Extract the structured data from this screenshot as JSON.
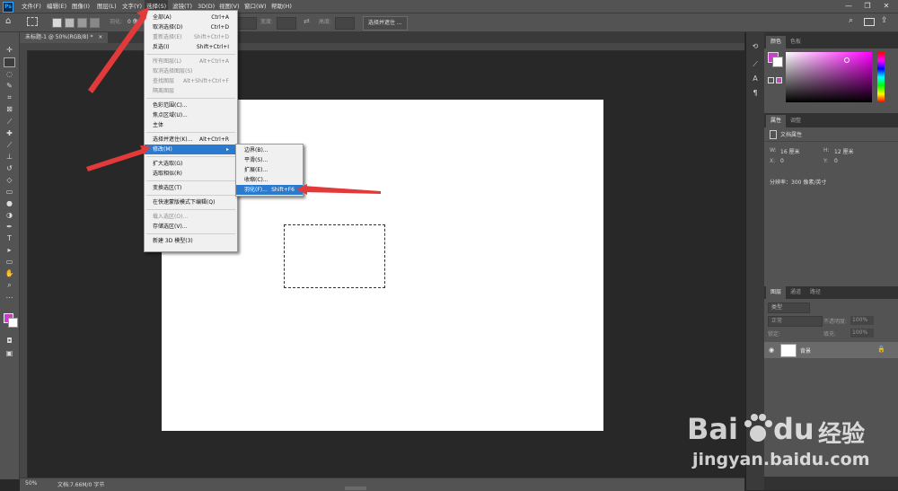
{
  "menubar": {
    "logo": "Ps",
    "items": [
      "文件(F)",
      "编辑(E)",
      "图像(I)",
      "图层(L)",
      "文字(Y)",
      "选择(S)",
      "滤镜(T)",
      "3D(D)",
      "视图(V)",
      "窗口(W)",
      "帮助(H)"
    ],
    "window_controls": [
      "—",
      "❐",
      "✕"
    ]
  },
  "options_bar": {
    "feather_label": "羽化:",
    "feather_value": "0 像素",
    "width_label": "宽度:",
    "height_label": "高度:",
    "select_mask_button": "选择并遮住 ..."
  },
  "document_tab": {
    "label": "未标题-1 @ 50%(RGB/8) *",
    "close": "×"
  },
  "status_bar": {
    "zoom": "50%",
    "doc_info": "文档:7.66M/0 字节"
  },
  "select_menu": {
    "groups": [
      [
        {
          "label": "全部(A)",
          "shortcut": "Ctrl+A",
          "disabled": false
        },
        {
          "label": "取消选择(D)",
          "shortcut": "Ctrl+D",
          "disabled": false
        },
        {
          "label": "重新选择(E)",
          "shortcut": "Shift+Ctrl+D",
          "disabled": true
        },
        {
          "label": "反选(I)",
          "shortcut": "Shift+Ctrl+I",
          "disabled": false
        }
      ],
      [
        {
          "label": "所有图层(L)",
          "shortcut": "Alt+Ctrl+A",
          "disabled": true
        },
        {
          "label": "取消选择图层(S)",
          "shortcut": "",
          "disabled": true
        },
        {
          "label": "查找图层",
          "shortcut": "Alt+Shift+Ctrl+F",
          "disabled": true
        },
        {
          "label": "隔离图层",
          "shortcut": "",
          "disabled": true
        }
      ],
      [
        {
          "label": "色彩范围(C)...",
          "shortcut": "",
          "disabled": false
        },
        {
          "label": "焦点区域(U)...",
          "shortcut": "",
          "disabled": false
        },
        {
          "label": "主体",
          "shortcut": "",
          "disabled": false
        }
      ],
      [
        {
          "label": "选择并遮住(K)...",
          "shortcut": "Alt+Ctrl+R",
          "disabled": false
        },
        {
          "label": "修改(M)",
          "shortcut": "",
          "disabled": false,
          "submenu": true,
          "highlighted": true
        }
      ],
      [
        {
          "label": "扩大选取(G)",
          "shortcut": "",
          "disabled": false
        },
        {
          "label": "选取相似(R)",
          "shortcut": "",
          "disabled": false
        }
      ],
      [
        {
          "label": "变换选区(T)",
          "shortcut": "",
          "disabled": false
        }
      ],
      [
        {
          "label": "在快速蒙版模式下编辑(Q)",
          "shortcut": "",
          "disabled": false
        }
      ],
      [
        {
          "label": "载入选区(O)...",
          "shortcut": "",
          "disabled": true
        },
        {
          "label": "存储选区(V)...",
          "shortcut": "",
          "disabled": false
        }
      ],
      [
        {
          "label": "新建 3D 模型(3)",
          "shortcut": "",
          "disabled": false
        }
      ]
    ]
  },
  "modify_submenu": {
    "items": [
      {
        "label": "边界(B)...",
        "shortcut": ""
      },
      {
        "label": "平滑(S)...",
        "shortcut": ""
      },
      {
        "label": "扩展(E)...",
        "shortcut": ""
      },
      {
        "label": "收缩(C)...",
        "shortcut": ""
      },
      {
        "label": "羽化(F)...",
        "shortcut": "Shift+F6",
        "highlighted": true
      }
    ]
  },
  "color_panel": {
    "tabs": [
      "颜色",
      "色板"
    ],
    "fg_color": "#c83fc8",
    "bg_color": "#ffffff"
  },
  "properties_panel": {
    "tabs": [
      "属性",
      "调整"
    ],
    "section": "文档属性",
    "w_label": "W:",
    "w_value": "16 厘米",
    "h_label": "H:",
    "h_value": "12 厘米",
    "x_label": "X:",
    "x_value": "0",
    "y_label": "Y:",
    "y_value": "0",
    "resolution": "分辨率：300 像素/英寸"
  },
  "layers_panel": {
    "tabs": [
      "图层",
      "通道",
      "路径"
    ],
    "kind_label": "类型",
    "mode": "正常",
    "opacity_label": "不透明度:",
    "opacity_value": "100%",
    "lock_label": "锁定:",
    "fill_label": "填充:",
    "fill_value": "100%",
    "layer_name": "背景"
  },
  "watermark": {
    "brand": "Bai",
    "brand2": "du",
    "cn": "经验",
    "url": "jingyan.baidu.com"
  },
  "colors": {
    "accent_red": "#e23a3a",
    "highlight": "#2a7bd0"
  }
}
